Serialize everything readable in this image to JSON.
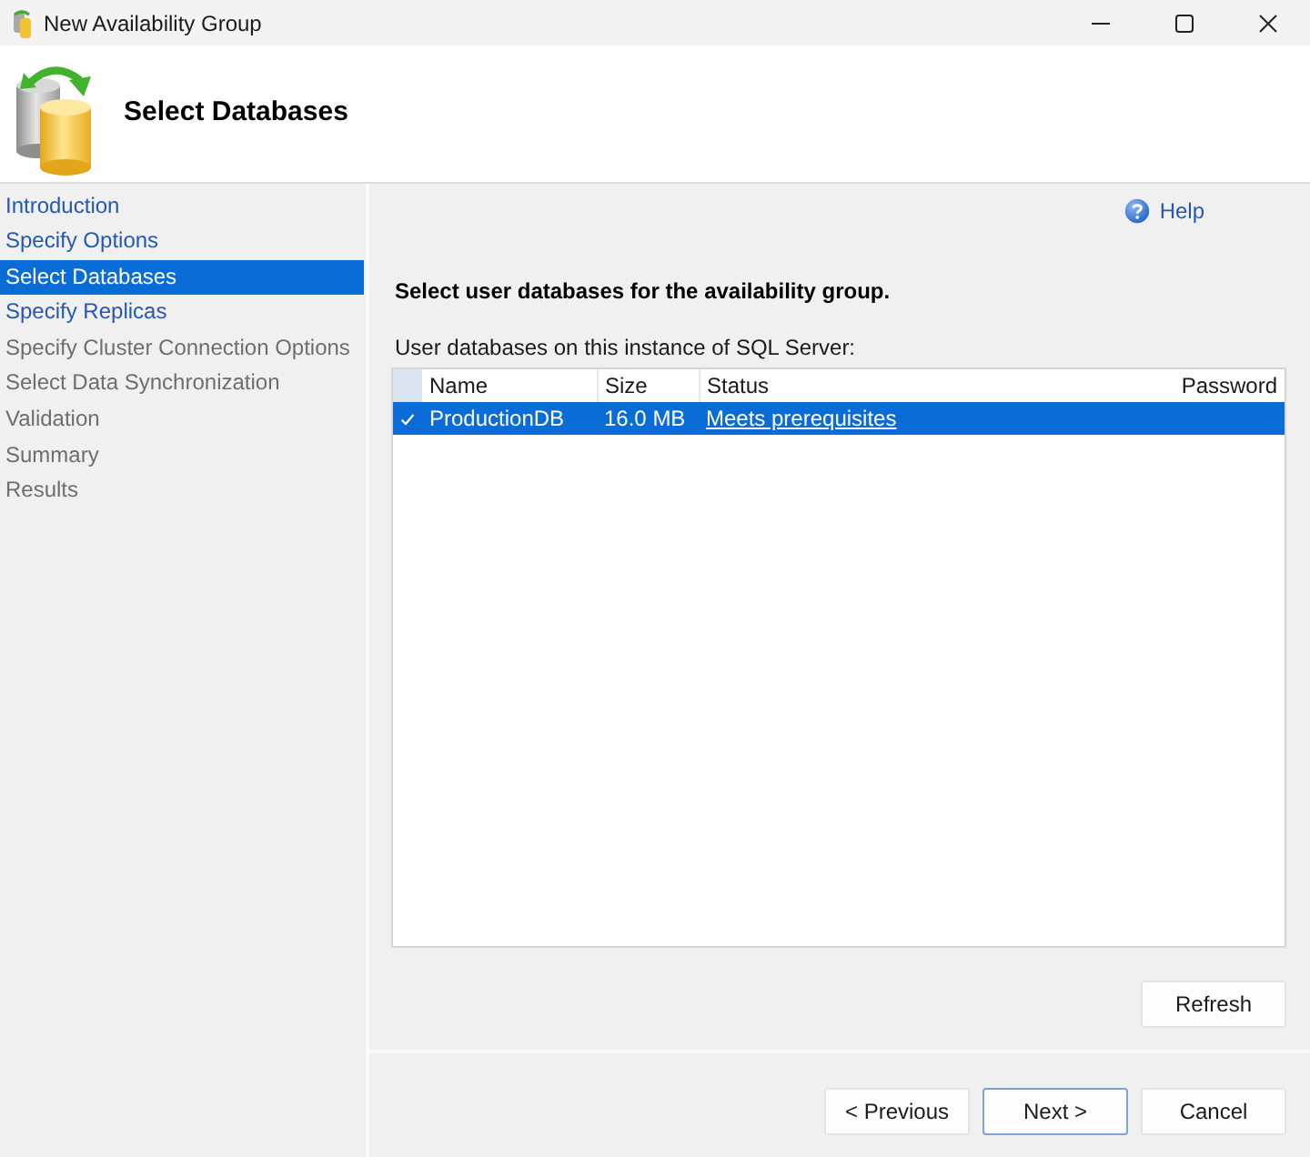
{
  "window": {
    "title": "New Availability Group"
  },
  "header": {
    "title": "Select Databases"
  },
  "steps": [
    {
      "label": "Introduction",
      "selected": false,
      "disabled": false
    },
    {
      "label": "Specify Options",
      "selected": false,
      "disabled": false
    },
    {
      "label": "Select Databases",
      "selected": true,
      "disabled": false
    },
    {
      "label": "Specify Replicas",
      "selected": false,
      "disabled": false
    },
    {
      "label": "Specify Cluster Connection Options",
      "selected": false,
      "disabled": true
    },
    {
      "label": "Select Data Synchronization",
      "selected": false,
      "disabled": true
    },
    {
      "label": "Validation",
      "selected": false,
      "disabled": true
    },
    {
      "label": "Summary",
      "selected": false,
      "disabled": true
    },
    {
      "label": "Results",
      "selected": false,
      "disabled": true
    }
  ],
  "help": {
    "label": "Help"
  },
  "instruction": "Select user databases for the availability group.",
  "grid": {
    "caption": "User databases on this instance of SQL Server:",
    "columns": [
      "Name",
      "Size",
      "Status",
      "Password"
    ],
    "rows": [
      {
        "checked": true,
        "selected": true,
        "name": "ProductionDB",
        "size": "16.0 MB",
        "status": "Meets prerequisites"
      }
    ]
  },
  "refresh_button": {
    "label": "Refresh"
  },
  "buttons": [
    {
      "label": "< Previous",
      "default": false
    },
    {
      "label": "Next >",
      "default": true
    },
    {
      "label": "Cancel",
      "default": false
    }
  ]
}
